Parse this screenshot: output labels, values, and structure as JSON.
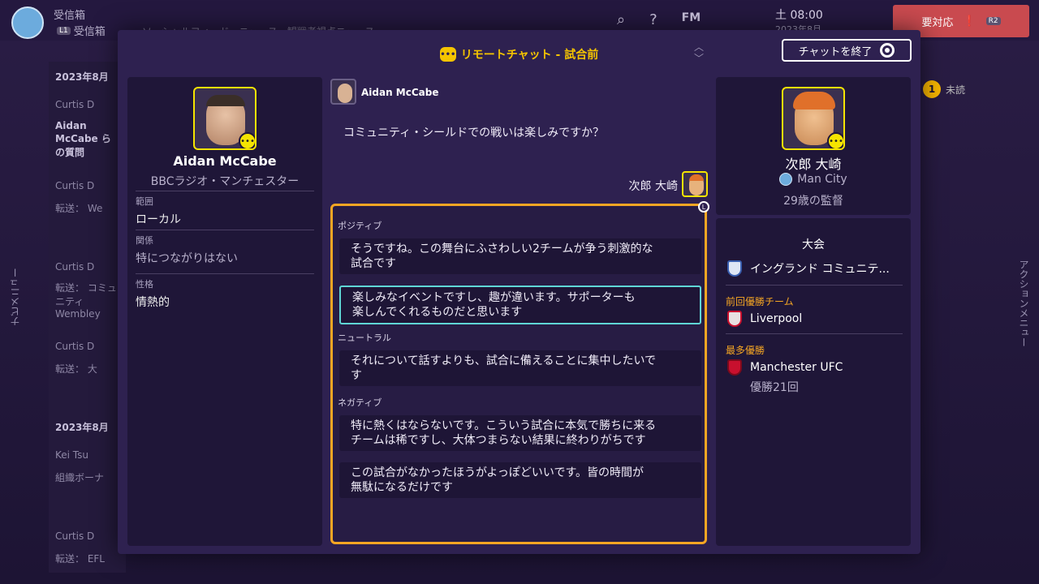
{
  "background": {
    "title": "受信箱",
    "subtitle": "受信箱",
    "subtitle_key": "L1",
    "tabs": "ソーシャルフィード　ニュース　観戦者視点ニュース",
    "clock_line1": "土 08:00",
    "clock_line2": "2023年8月",
    "urgent": "要対応",
    "urgent_key": "R2",
    "fm_label": "FM",
    "nav_menu": "ナビメニュー",
    "action_menu": "アクションメニュー",
    "unread_count": "1",
    "unread_label": "未読",
    "left_rows": [
      "2023年8月",
      "Curtis D",
      "Aidan McCabe らの質問",
      "Curtis D",
      "転送： We",
      "Curtis D",
      "転送： コミュニティ Wembley",
      "Curtis D",
      "転送： 大",
      "2023年8月",
      "Kei Tsu",
      "組織ボーナ",
      "Curtis D",
      "転送： EFL"
    ]
  },
  "modal": {
    "title": "リモートチャット - 試合前",
    "end_chat_label": "チャットを終了"
  },
  "journalist": {
    "name": "Aidan McCabe",
    "outlet": "BBCラジオ・マンチェスター",
    "attributes": [
      {
        "key": "範囲",
        "value": "ローカル"
      },
      {
        "key": "関係",
        "value": "特につながりはない"
      },
      {
        "key": "性格",
        "value": "情熱的"
      }
    ]
  },
  "conversation": {
    "journalist_label": "Aidan McCabe",
    "question": "コミュニティ・シールドでの戦いは楽しみですか？",
    "manager_label": "次郎 大崎",
    "categories": {
      "positive": "ポジティブ",
      "neutral": "ニュートラル",
      "negative": "ネガティブ"
    },
    "options": [
      {
        "line1": "そうですね。この舞台にふさわしい2チームが争う刺激的な",
        "line2": "試合です"
      },
      {
        "line1": "楽しみなイベントですし、趣が違います。サポーターも",
        "line2": "楽しんでくれるものだと思います"
      },
      {
        "line1": "それについて話すよりも、試合に備えることに集中したいで",
        "line2": "す"
      },
      {
        "line1": "特に熱くはならないです。こういう試合に本気で勝ちに来る",
        "line2": "チームは稀ですし、大体つまらない結果に終わりがちです"
      },
      {
        "line1": "この試合がなかったほうがよっぽどいいです。皆の時間が",
        "line2": "無駄になるだけです"
      }
    ],
    "badge": "L"
  },
  "manager": {
    "name": "次郎 大崎",
    "club": "Man City",
    "age": "29歳の監督"
  },
  "competition": {
    "heading": "大会",
    "name": "イングランド コミュニテ...",
    "prev_winner_label": "前回優勝チーム",
    "prev_winner": "Liverpool",
    "most_wins_label": "最多優勝",
    "most_wins_team": "Manchester UFC",
    "most_wins_count": "優勝21回"
  },
  "colors": {
    "accent_yellow": "#f5c400",
    "answer_border": "#f5a623",
    "selected_border": "#5fd6d6",
    "modal_bg": "#2e2150"
  }
}
